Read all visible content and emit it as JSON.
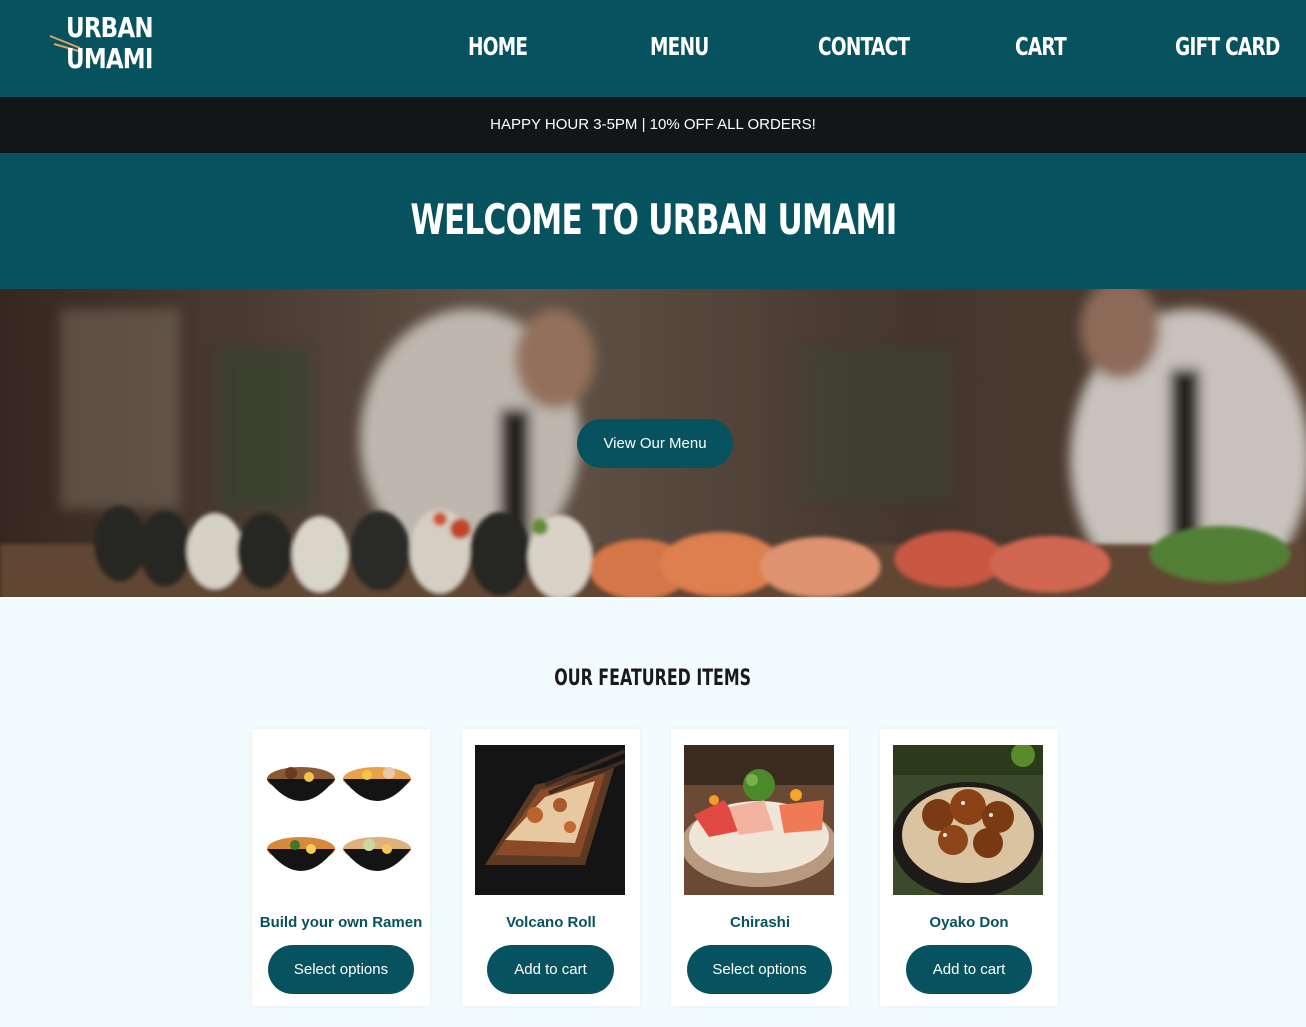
{
  "brand": {
    "line1": "URBAN",
    "line2": "UMAMI"
  },
  "nav": [
    "HOME",
    "MENU",
    "CONTACT",
    "CART",
    "GIFT CARD"
  ],
  "promo": "HAPPY HOUR 3-5PM | 10% OFF ALL ORDERS!",
  "welcome": "WELCOME TO URBAN UMAMI",
  "hero": {
    "button": "View Our Menu"
  },
  "featured": {
    "title": "OUR FEATURED ITEMS",
    "items": [
      {
        "name": "Build your own Ramen",
        "button": "Select options"
      },
      {
        "name": "Volcano Roll",
        "button": "Add to cart"
      },
      {
        "name": "Chirashi",
        "button": "Select options"
      },
      {
        "name": "Oyako Don",
        "button": "Add to cart"
      }
    ]
  },
  "colors": {
    "primary": "#07525f",
    "promo_bar": "#131618",
    "page_bg": "#f2fbfd"
  }
}
